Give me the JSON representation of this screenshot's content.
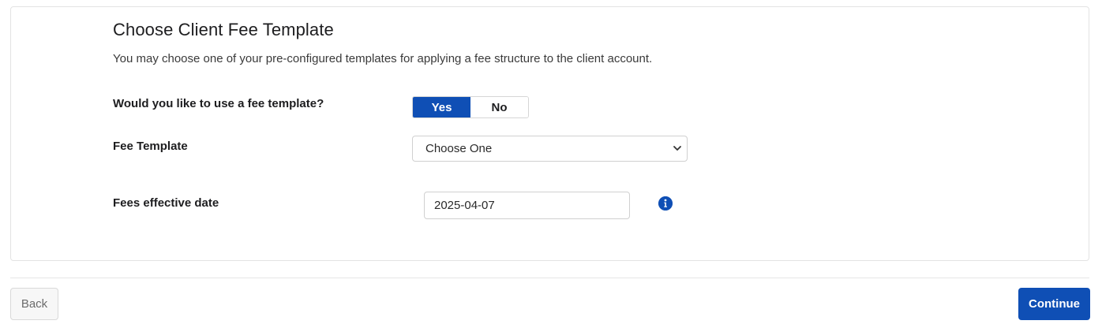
{
  "section": {
    "title": "Choose Client Fee Template",
    "description": "You may choose one of your pre-configured templates for applying a fee structure to the client account."
  },
  "fee_template_question": {
    "label": "Would you like to use a fee template?",
    "options": [
      "Yes",
      "No"
    ],
    "selected": "Yes"
  },
  "fee_template": {
    "label": "Fee Template",
    "selected_value": "Choose One"
  },
  "fees_effective_date": {
    "label": "Fees effective date",
    "value": "2025-04-07",
    "info_icon": "info-icon"
  },
  "footer": {
    "back_label": "Back",
    "continue_label": "Continue"
  },
  "colors": {
    "primary": "#0f4fb5",
    "border": "#d0d0d0"
  }
}
